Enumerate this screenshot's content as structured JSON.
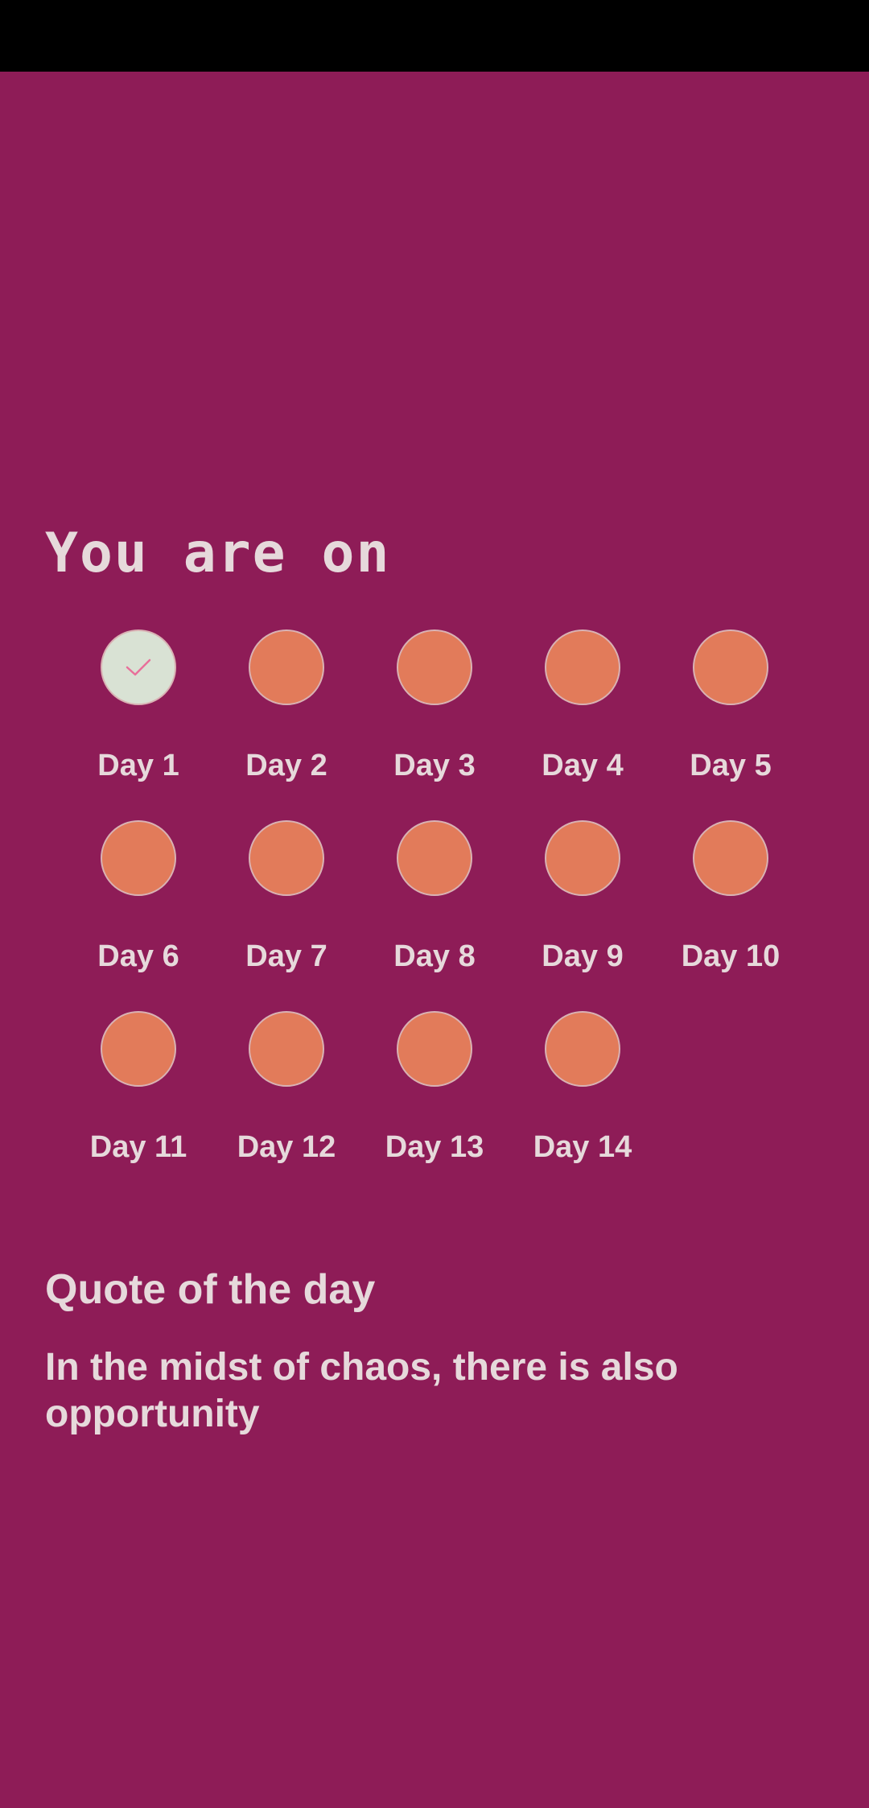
{
  "heading": "You are on",
  "colors": {
    "background": "#8E1C57",
    "status_bar": "#000000",
    "day_pending": "#E27B5A",
    "day_completed": "#D9E2D4",
    "check_mark": "#E8709A",
    "text": "#E6D9DB"
  },
  "days": [
    {
      "label": "Day 1",
      "completed": true,
      "icon": "check-icon"
    },
    {
      "label": "Day 2",
      "completed": false
    },
    {
      "label": "Day 3",
      "completed": false
    },
    {
      "label": "Day 4",
      "completed": false
    },
    {
      "label": "Day 5",
      "completed": false
    },
    {
      "label": "Day 6",
      "completed": false
    },
    {
      "label": "Day 7",
      "completed": false
    },
    {
      "label": "Day 8",
      "completed": false
    },
    {
      "label": "Day 9",
      "completed": false
    },
    {
      "label": "Day 10",
      "completed": false
    },
    {
      "label": "Day 11",
      "completed": false
    },
    {
      "label": "Day 12",
      "completed": false
    },
    {
      "label": "Day 13",
      "completed": false
    },
    {
      "label": "Day 14",
      "completed": false
    }
  ],
  "quote": {
    "title": "Quote of the day",
    "text": "In the midst of chaos, there is also opportunity"
  }
}
